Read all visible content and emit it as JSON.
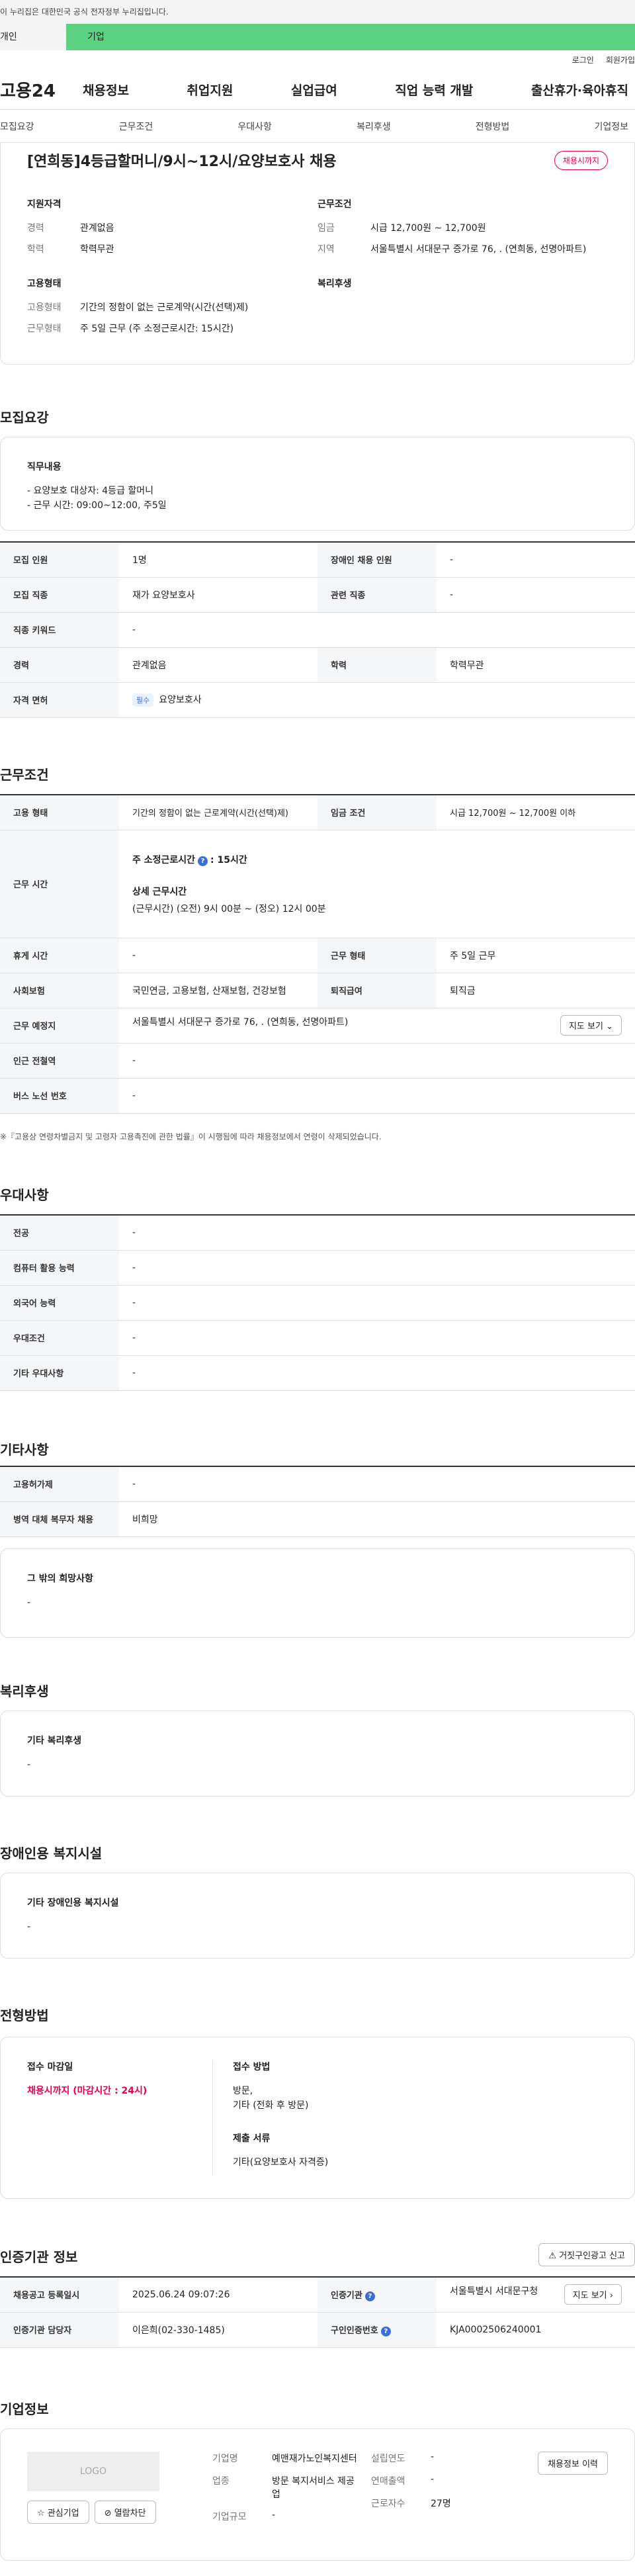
{
  "gov_bar": "이 누리집은 대한민국 공식 전자정부 누리집입니다.",
  "tabs": [
    "개인",
    "기업"
  ],
  "util": [
    "로그인",
    "회원가입"
  ],
  "logo": "고용24",
  "gnb": [
    "채용정보",
    "취업지원",
    "실업급여",
    "직업 능력 개발",
    "출산휴가·육아휴직"
  ],
  "anchors": [
    "모집요강",
    "근무조건",
    "우대사항",
    "복리후생",
    "전형방법",
    "기업정보"
  ],
  "summary": {
    "title": "[연희동]4등급할머니/9시~12시/요양보호사 채용",
    "badge": "채용시까지",
    "qual_title": "지원자격",
    "career_k": "경력",
    "career_v": "관계없음",
    "edu_k": "학력",
    "edu_v": "학력무관",
    "cond_title": "근무조건",
    "wage_k": "임금",
    "wage_v": "시급 12,700원 ~ 12,700원",
    "region_k": "지역",
    "region_v": "서울특별시 서대문구 증가로 76, . (연희동, 선명아파트)",
    "emp_title": "고용형태",
    "emp_k": "고용형태",
    "emp_v": "기간의 정함이 없는 근로계약(시간(선택)제)",
    "work_k": "근무형태",
    "work_v": "주 5일 근무 (주 소정근로시간: 15시간)",
    "welfare_title": "복리후생"
  },
  "recruit": {
    "title": "모집요강",
    "duty_title": "직무내용",
    "duty_lines": [
      "- 요양보호 대상자: 4등급 할머니",
      "- 근무 시간: 09:00~12:00, 주5일"
    ],
    "rows": {
      "headcount_k": "모집 인원",
      "headcount_v": "1명",
      "disabled_k": "장애인 채용 인원",
      "disabled_v": "-",
      "job_k": "모집 직종",
      "job_v": "재가 요양보호사",
      "related_k": "관련 직종",
      "related_v": "-",
      "keyword_k": "직종 키워드",
      "keyword_v": "-",
      "career_k": "경력",
      "career_v": "관계없음",
      "edu_k": "학력",
      "edu_v": "학력무관",
      "license_k": "자격 면허",
      "license_tag": "필수",
      "license_v": "요양보호사"
    }
  },
  "conditions": {
    "title": "근무조건",
    "emp_k": "고용 형태",
    "emp_v": "기간의 정함이 없는 근로계약(시간(선택)제)",
    "wage_k": "임금 조건",
    "wage_v": "시급 12,700원 ~ 12,700원 이하",
    "hours_k": "근무 시간",
    "hours_main": "주 소정근로시간",
    "hours_main_v": ": 15시간",
    "hours_detail_title": "상세 근무시간",
    "hours_detail": "(근무시간) (오전) 9시 00분 ~ (정오) 12시 00분",
    "rest_k": "휴게 시간",
    "rest_v": "-",
    "form_k": "근무 형태",
    "form_v": "주 5일 근무",
    "ins_k": "사회보험",
    "ins_v": "국민연금, 고용보험, 산재보험, 건강보험",
    "retire_k": "퇴직급여",
    "retire_v": "퇴직금",
    "place_k": "근무 예정지",
    "place_v": "서울특별시 서대문구 증가로 76, . (연희동, 선명아파트)",
    "map_btn": "지도 보기",
    "station_k": "인근 전철역",
    "station_v": "-",
    "bus_k": "버스 노선 번호",
    "bus_v": "-",
    "note": "※『고용상 연령차별금지 및 고령자 고용촉진에 관한 법률』이 시행됨에 따라 채용정보에서 연령이 삭제되었습니다."
  },
  "preference": {
    "title": "우대사항",
    "major_k": "전공",
    "major_v": "-",
    "computer_k": "컴퓨터 활용 능력",
    "computer_v": "-",
    "lang_k": "외국어 능력",
    "lang_v": "-",
    "cond_k": "우대조건",
    "cond_v": "-",
    "etc_k": "기타 우대사항",
    "etc_v": "-"
  },
  "other": {
    "title": "기타사항",
    "device_k": "고용허가제",
    "device_v": "-",
    "military_k": "병역 대체 복무자 채용",
    "military_v": "비희망",
    "wish_title": "그 밖의 희망사항",
    "wish_v": "-"
  },
  "welfare": {
    "title": "복리후생",
    "box_title": "기타 복리후생",
    "box_v": "-"
  },
  "disability": {
    "title": "장애인용 복지시설",
    "box_title": "기타 장애인용 복지시설",
    "box_v": "-"
  },
  "selection": {
    "title": "전형방법",
    "deadline_k": "접수 마감일",
    "deadline_v": "채용시까지 (마감시간 : 24시)",
    "method_k": "접수 방법",
    "method_v1": "방문,",
    "method_v2": "기타 (전화 후 방문)",
    "docs_k": "제출 서류",
    "docs_v": "기타(요양보호사 자격증)"
  },
  "cert": {
    "title": "인증기관 정보",
    "report_btn": "거짓구인광고 신고",
    "reg_k": "채용공고 등록일시",
    "reg_v": "2025.06.24 09:07:26",
    "agency_k": "인증기관",
    "agency_v": "서울특별시 서대문구청",
    "map_btn": "지도 보기",
    "manager_k": "인증기관 담당자",
    "manager_v": "이은희(02-330-1485)",
    "num_k": "구인인증번호",
    "num_v": "KJA0002506240001"
  },
  "company": {
    "title": "기업정보",
    "logo": "LOGO",
    "fav_btn": "관심기업",
    "block_btn": "열람차단",
    "history_btn": "채용정보 이력",
    "name_k": "기업명",
    "name_v": "예맨재가노인복지센터",
    "found_k": "설립연도",
    "found_v": "-",
    "sales_k": "연매출액",
    "sales_v": "-",
    "biz_k": "업종",
    "biz_v": "방문 복지서비스 제공업",
    "staff_k": "근로자수",
    "staff_v": "27명",
    "size_k": "기업규모",
    "size_v": "-"
  }
}
